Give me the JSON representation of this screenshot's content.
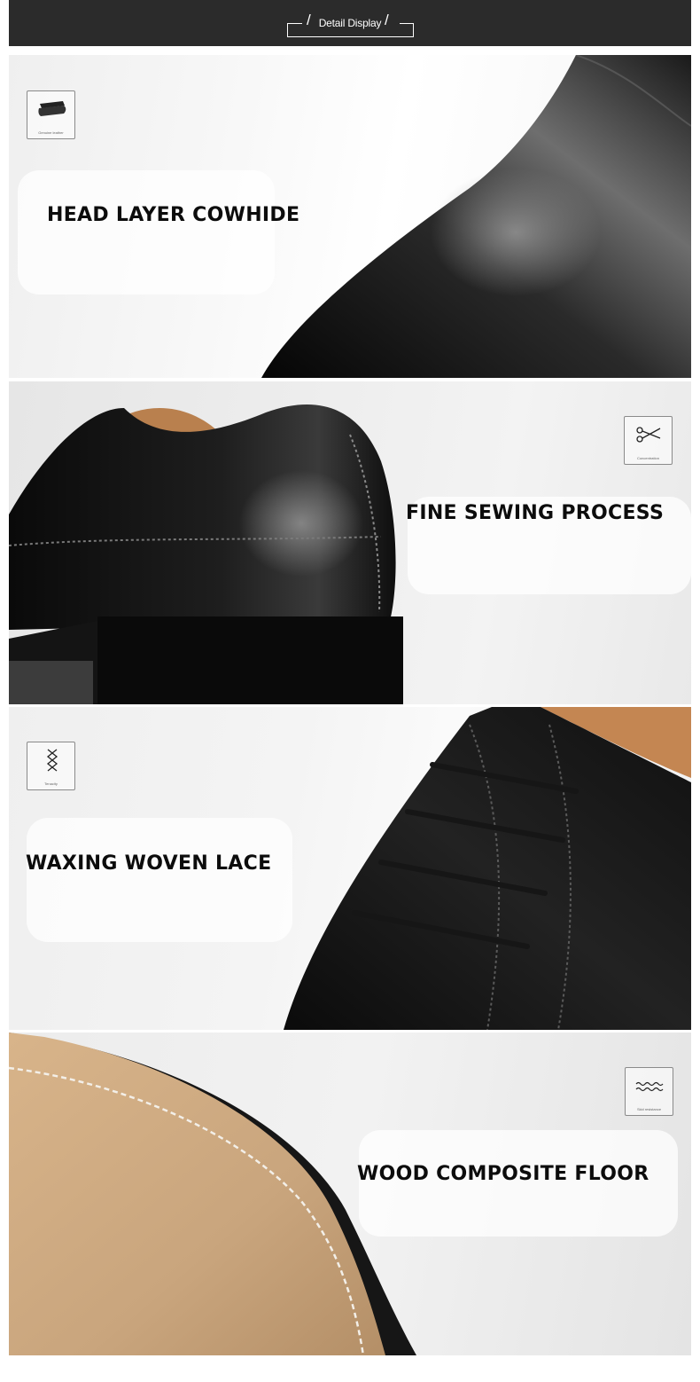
{
  "header": {
    "title": "Detail Display",
    "slash": "/"
  },
  "features": [
    {
      "title": "HEAD LAYER COWHIDE",
      "icon": "leather-icon",
      "icon_caption": "Genuine leather"
    },
    {
      "title": "FINE SEWING PROCESS",
      "icon": "scissors-icon",
      "icon_caption": "Concentration"
    },
    {
      "title": "WAXING WOVEN LACE",
      "icon": "lace-icon",
      "icon_caption": "Tenacity"
    },
    {
      "title": "WOOD COMPOSITE FLOOR",
      "icon": "wave-icon",
      "icon_caption": "Skid resistance"
    }
  ],
  "colors": {
    "header_bg": "#2b2b2b",
    "title_text": "#0c0c0c",
    "leather": "#101010",
    "sole": "#c9a781"
  }
}
